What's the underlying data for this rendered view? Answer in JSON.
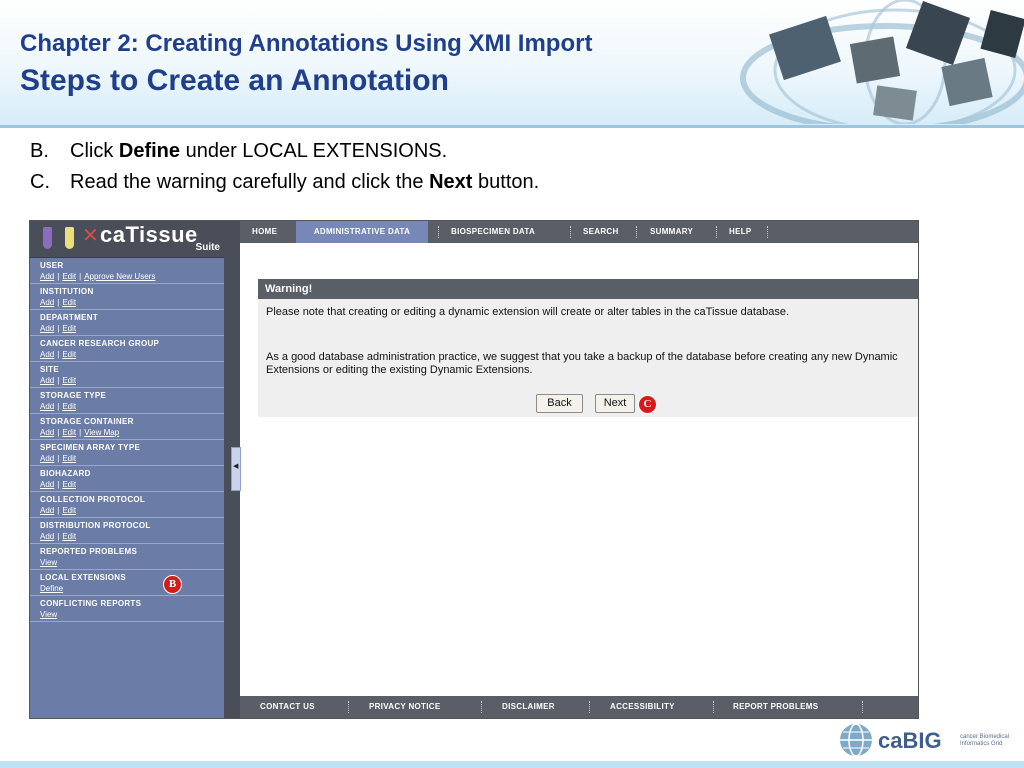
{
  "slide": {
    "chapter_title": "Chapter 2: Creating Annotations Using XMI Import",
    "slide_title": "Steps to Create an Annotation",
    "steps": [
      {
        "letter": "B.",
        "pre": "Click ",
        "bold": "Define",
        "post": " under LOCAL EXTENSIONS."
      },
      {
        "letter": "C.",
        "pre": "Read the warning carefully and click the ",
        "bold": "Next",
        "post": " button."
      }
    ]
  },
  "app": {
    "logo": {
      "name": "caTissue",
      "suite": "Suite"
    },
    "sidebar": [
      {
        "title": "USER",
        "links": [
          "Add",
          "Edit",
          "Approve New Users"
        ]
      },
      {
        "title": "INSTITUTION",
        "links": [
          "Add",
          "Edit"
        ]
      },
      {
        "title": "DEPARTMENT",
        "links": [
          "Add",
          "Edit"
        ]
      },
      {
        "title": "CANCER RESEARCH GROUP",
        "links": [
          "Add",
          "Edit"
        ]
      },
      {
        "title": "SITE",
        "links": [
          "Add",
          "Edit"
        ]
      },
      {
        "title": "STORAGE TYPE",
        "links": [
          "Add",
          "Edit"
        ]
      },
      {
        "title": "STORAGE CONTAINER",
        "links": [
          "Add",
          "Edit",
          "View Map"
        ]
      },
      {
        "title": "SPECIMEN ARRAY TYPE",
        "links": [
          "Add",
          "Edit"
        ]
      },
      {
        "title": "BIOHAZARD",
        "links": [
          "Add",
          "Edit"
        ]
      },
      {
        "title": "COLLECTION PROTOCOL",
        "links": [
          "Add",
          "Edit"
        ]
      },
      {
        "title": "DISTRIBUTION PROTOCOL",
        "links": [
          "Add",
          "Edit"
        ]
      },
      {
        "title": "REPORTED PROBLEMS",
        "links": [
          "View"
        ]
      },
      {
        "title": "LOCAL EXTENSIONS",
        "links": [
          "Define"
        ]
      },
      {
        "title": "CONFLICTING REPORTS",
        "links": [
          "View"
        ]
      }
    ],
    "topnav": [
      "HOME",
      "ADMINISTRATIVE DATA",
      "BIOSPECIMEN DATA",
      "SEARCH",
      "SUMMARY",
      "HELP"
    ],
    "warning": {
      "heading": "Warning!",
      "para1": "Please note that creating or editing a dynamic extension will create or alter tables in the caTissue database.",
      "para2": "As a good database administration practice, we suggest that you take a backup of the database before creating any new Dynamic Extensions or editing the existing Dynamic Extensions.",
      "back_label": "Back",
      "next_label": "Next"
    },
    "footer": [
      "CONTACT US",
      "PRIVACY NOTICE",
      "DISCLAIMER",
      "ACCESSIBILITY",
      "REPORT PROBLEMS"
    ],
    "markers": {
      "b": "B",
      "c": "C"
    }
  },
  "cabig": {
    "name": "caBIG",
    "tagline": "cancer Biomedical Informatics Grid"
  },
  "colors": {
    "title_blue": "#1f3f8a",
    "sidebar": "#6b7ca7",
    "nav_gray": "#5a5e66",
    "marker_red": "#d81a1a"
  }
}
